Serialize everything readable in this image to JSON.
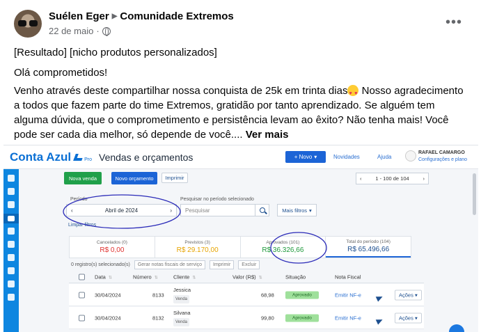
{
  "post": {
    "author": "Suélen Eger",
    "group": "Comunidade Extremos",
    "date": "22 de maio",
    "line1": "[Resultado] [nicho produtos personalizados]",
    "line2": "Olá comprometidos!",
    "body_part1": "Venho através deste compartilhar nossa conquista de 25k em trinta dias",
    "body_part2": " Nosso agradecimento a todos que fazem parte do time Extremos, gratidão por tanto aprendizado. Se alguém tem alguma dúvida, que o comprometimento e persistência levam ao êxito?  Não tenha mais! Você pode ser cada dia melhor, só depende de você.... ",
    "see_more": "Ver mais",
    "emoji": "heart-eyes-emoji"
  },
  "app": {
    "brand": "Conta Azul",
    "brand_pro": "Pro",
    "title": "Vendas e orçamentos",
    "btn_novo": "+ Novo",
    "novidades": "Novidades",
    "ajuda": "Ajuda",
    "user_name": "RAFAEL CAMARGO",
    "user_sub": "Configurações e plano",
    "btn_nova_venda": "Nova venda",
    "btn_novo_orcamento": "Novo orçamento",
    "btn_imprimir": "Imprimir",
    "pager_label": "1 - 100 de 104",
    "periodo_label": "Período",
    "periodo_value": "Abril de 2024",
    "pesquisar_label": "Pesquisar no período selecionado",
    "pesquisar_placeholder": "Pesquisar",
    "mais_filtros": "Mais filtros",
    "limpar_filtros": "Limpar filtros",
    "totals": [
      {
        "label": "Cancelados (0)",
        "value": "R$ 0,00",
        "color": "#e0322f"
      },
      {
        "label": "Previstos (3)",
        "value": "R$ 29.170,00",
        "color": "#e7a400"
      },
      {
        "label": "Aprovados (101)",
        "value": "R$ 36.326,66",
        "color": "#1f9a3c"
      },
      {
        "label": "Total do período (104)",
        "value": "R$ 65.496,66",
        "color": "#1d4f8f"
      }
    ],
    "bulk_selected": "0 registro(s) selecionado(s)",
    "bulk_nfs": "Gerar notas fiscais de serviço",
    "bulk_imprimir": "Imprimir",
    "bulk_excluir": "Excluir",
    "columns": [
      "Data",
      "Número",
      "Cliente",
      "Valor (R$)",
      "Situação",
      "Nota Fiscal"
    ],
    "rows": [
      {
        "data": "30/04/2024",
        "numero": "8133",
        "cliente": "Jessica",
        "tipo": "Venda",
        "valor": "68,98",
        "situacao": "Aprovado",
        "nf": "Emitir NF-e",
        "acoes": "Ações"
      },
      {
        "data": "30/04/2024",
        "numero": "8132",
        "cliente": "Silvana",
        "tipo": "Venda",
        "valor": "99,80",
        "situacao": "Aprovado",
        "nf": "Emitir NF-e",
        "acoes": "Ações"
      }
    ]
  }
}
